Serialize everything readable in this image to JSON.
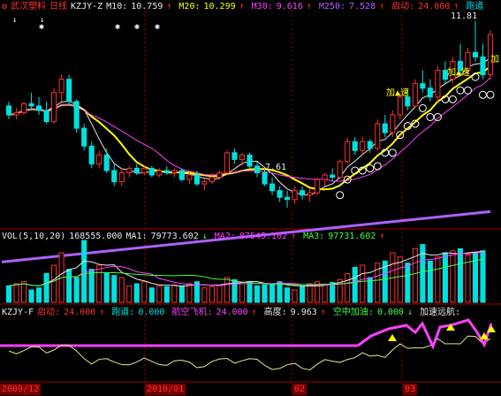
{
  "main_legend": {
    "title": "武汉塑料",
    "period": "日线",
    "indicator": "KZJY-Z",
    "m10_label": "M10:",
    "m10_val": "10.759",
    "m20_label": "M20:",
    "m20_val": "10.299",
    "m30_label": "M30:",
    "m30_val": "9.616",
    "m250_label": "M250:",
    "m250_val": "7.528",
    "start_label": "启动:",
    "start_val": "24.000",
    "run_label": "跑道"
  },
  "vol_legend": {
    "name": "VOL(5,10,20)",
    "vol": "168555.000",
    "ma1_label": "MA1:",
    "ma1_val": "79773.602",
    "ma2_label": "MA2:",
    "ma2_val": "87545.102",
    "ma3_label": "MA3:",
    "ma3_val": "97731.602"
  },
  "ind_legend": {
    "name": "KZJY-F",
    "start_label": "启动:",
    "start_val": "24.000",
    "run_label": "跑道:",
    "run_val": "0.000",
    "fly_label": "航空飞机:",
    "fly_val": "24.000",
    "height_label": "高度:",
    "height_val": "9.963",
    "refuel_label": "空中加油:",
    "refuel_val": "0.000",
    "accel_label": "加速远航:"
  },
  "annotations": {
    "high": "11.81",
    "low": "7.61",
    "accel1": "加▲速",
    "accel2": "加▲速",
    "accel_edge": "加"
  },
  "dates": [
    "2009/12",
    "2010/01",
    "02",
    "03"
  ],
  "colors": {
    "up": "#ff3030",
    "down": "#00e0e0",
    "ma_white": "#e8e8e8",
    "ma_yellow": "#ffff00",
    "ma_magenta": "#ff40ff",
    "ma250": "#b060ff",
    "grid_red": "#a00000"
  },
  "chart_data": {
    "type": "candlestick",
    "price_series": [
      {
        "o": 9.9,
        "h": 10.0,
        "l": 9.6,
        "c": 9.7
      },
      {
        "o": 9.7,
        "h": 9.85,
        "l": 9.6,
        "c": 9.75
      },
      {
        "o": 9.75,
        "h": 10.0,
        "l": 9.7,
        "c": 9.95
      },
      {
        "o": 9.95,
        "h": 10.2,
        "l": 9.8,
        "c": 9.9
      },
      {
        "o": 9.9,
        "h": 10.1,
        "l": 9.7,
        "c": 9.8
      },
      {
        "o": 9.8,
        "h": 10.0,
        "l": 9.5,
        "c": 9.55
      },
      {
        "o": 9.55,
        "h": 10.3,
        "l": 9.5,
        "c": 10.2
      },
      {
        "o": 10.2,
        "h": 10.6,
        "l": 10.0,
        "c": 10.5
      },
      {
        "o": 10.5,
        "h": 10.6,
        "l": 9.9,
        "c": 10.0
      },
      {
        "o": 10.0,
        "h": 10.05,
        "l": 9.3,
        "c": 9.4
      },
      {
        "o": 9.4,
        "h": 9.5,
        "l": 8.9,
        "c": 9.0
      },
      {
        "o": 9.0,
        "h": 9.1,
        "l": 8.5,
        "c": 8.6
      },
      {
        "o": 8.6,
        "h": 8.9,
        "l": 8.5,
        "c": 8.8
      },
      {
        "o": 8.8,
        "h": 8.95,
        "l": 8.4,
        "c": 8.45
      },
      {
        "o": 8.45,
        "h": 8.6,
        "l": 8.1,
        "c": 8.2
      },
      {
        "o": 8.2,
        "h": 8.5,
        "l": 8.1,
        "c": 8.4
      },
      {
        "o": 8.4,
        "h": 8.55,
        "l": 8.3,
        "c": 8.5
      },
      {
        "o": 8.5,
        "h": 8.6,
        "l": 8.35,
        "c": 8.4
      },
      {
        "o": 8.4,
        "h": 8.55,
        "l": 8.35,
        "c": 8.5
      },
      {
        "o": 8.5,
        "h": 8.55,
        "l": 8.3,
        "c": 8.35
      },
      {
        "o": 8.35,
        "h": 8.5,
        "l": 8.3,
        "c": 8.45
      },
      {
        "o": 8.45,
        "h": 8.55,
        "l": 8.35,
        "c": 8.4
      },
      {
        "o": 8.4,
        "h": 8.5,
        "l": 8.3,
        "c": 8.45
      },
      {
        "o": 8.45,
        "h": 8.5,
        "l": 8.2,
        "c": 8.25
      },
      {
        "o": 8.25,
        "h": 8.4,
        "l": 8.15,
        "c": 8.35
      },
      {
        "o": 8.35,
        "h": 8.45,
        "l": 8.1,
        "c": 8.15
      },
      {
        "o": 8.15,
        "h": 8.25,
        "l": 8.0,
        "c": 8.2
      },
      {
        "o": 8.2,
        "h": 8.4,
        "l": 8.15,
        "c": 8.3
      },
      {
        "o": 8.3,
        "h": 8.45,
        "l": 8.25,
        "c": 8.4
      },
      {
        "o": 8.4,
        "h": 8.9,
        "l": 8.35,
        "c": 8.85
      },
      {
        "o": 8.85,
        "h": 8.95,
        "l": 8.6,
        "c": 8.7
      },
      {
        "o": 8.7,
        "h": 8.85,
        "l": 8.55,
        "c": 8.8
      },
      {
        "o": 8.8,
        "h": 8.85,
        "l": 8.5,
        "c": 8.55
      },
      {
        "o": 8.55,
        "h": 8.65,
        "l": 8.3,
        "c": 8.4
      },
      {
        "o": 8.4,
        "h": 8.5,
        "l": 8.1,
        "c": 8.15
      },
      {
        "o": 8.15,
        "h": 8.3,
        "l": 7.9,
        "c": 8.0
      },
      {
        "o": 8.0,
        "h": 8.1,
        "l": 7.75,
        "c": 7.85
      },
      {
        "o": 7.85,
        "h": 8.0,
        "l": 7.61,
        "c": 7.8
      },
      {
        "o": 7.8,
        "h": 8.1,
        "l": 7.7,
        "c": 8.0
      },
      {
        "o": 8.0,
        "h": 8.1,
        "l": 7.8,
        "c": 7.9
      },
      {
        "o": 7.9,
        "h": 8.05,
        "l": 7.75,
        "c": 7.95
      },
      {
        "o": 7.95,
        "h": 8.3,
        "l": 7.9,
        "c": 8.25
      },
      {
        "o": 8.25,
        "h": 8.4,
        "l": 8.1,
        "c": 8.35
      },
      {
        "o": 8.35,
        "h": 8.5,
        "l": 8.2,
        "c": 8.3
      },
      {
        "o": 8.3,
        "h": 8.7,
        "l": 8.25,
        "c": 8.65
      },
      {
        "o": 8.65,
        "h": 9.2,
        "l": 8.6,
        "c": 9.1
      },
      {
        "o": 9.1,
        "h": 9.2,
        "l": 8.8,
        "c": 8.9
      },
      {
        "o": 8.9,
        "h": 9.2,
        "l": 8.8,
        "c": 9.1
      },
      {
        "o": 9.1,
        "h": 9.15,
        "l": 8.85,
        "c": 8.95
      },
      {
        "o": 8.95,
        "h": 9.6,
        "l": 8.9,
        "c": 9.5
      },
      {
        "o": 9.5,
        "h": 9.7,
        "l": 9.2,
        "c": 9.3
      },
      {
        "o": 9.3,
        "h": 9.8,
        "l": 9.2,
        "c": 9.7
      },
      {
        "o": 9.7,
        "h": 10.2,
        "l": 9.6,
        "c": 10.1
      },
      {
        "o": 10.1,
        "h": 10.3,
        "l": 9.8,
        "c": 9.9
      },
      {
        "o": 9.9,
        "h": 10.5,
        "l": 9.85,
        "c": 10.4
      },
      {
        "o": 10.4,
        "h": 10.7,
        "l": 10.2,
        "c": 10.3
      },
      {
        "o": 10.3,
        "h": 10.5,
        "l": 10.0,
        "c": 10.1
      },
      {
        "o": 10.1,
        "h": 10.8,
        "l": 10.0,
        "c": 10.7
      },
      {
        "o": 10.7,
        "h": 10.9,
        "l": 10.4,
        "c": 10.5
      },
      {
        "o": 10.5,
        "h": 11.0,
        "l": 10.4,
        "c": 10.9
      },
      {
        "o": 10.9,
        "h": 11.3,
        "l": 10.6,
        "c": 10.7
      },
      {
        "o": 10.7,
        "h": 11.2,
        "l": 10.6,
        "c": 11.1
      },
      {
        "o": 11.1,
        "h": 11.81,
        "l": 10.9,
        "c": 11.0
      },
      {
        "o": 11.0,
        "h": 11.3,
        "l": 10.5,
        "c": 10.6
      },
      {
        "o": 10.6,
        "h": 11.6,
        "l": 10.5,
        "c": 11.5
      }
    ],
    "volume": [
      40,
      45,
      50,
      30,
      35,
      70,
      90,
      120,
      80,
      60,
      150,
      80,
      90,
      70,
      65,
      60,
      40,
      45,
      50,
      35,
      40,
      38,
      42,
      40,
      45,
      50,
      35,
      38,
      42,
      60,
      55,
      45,
      50,
      40,
      42,
      45,
      50,
      35,
      30,
      38,
      45,
      50,
      42,
      48,
      55,
      70,
      85,
      90,
      60,
      95,
      100,
      120,
      110,
      95,
      130,
      140,
      100,
      110,
      120,
      125,
      130,
      115,
      120,
      125
    ],
    "price_ylim": [
      7.2,
      12.0
    ],
    "ma250_range": [
      6.4,
      7.53
    ]
  }
}
